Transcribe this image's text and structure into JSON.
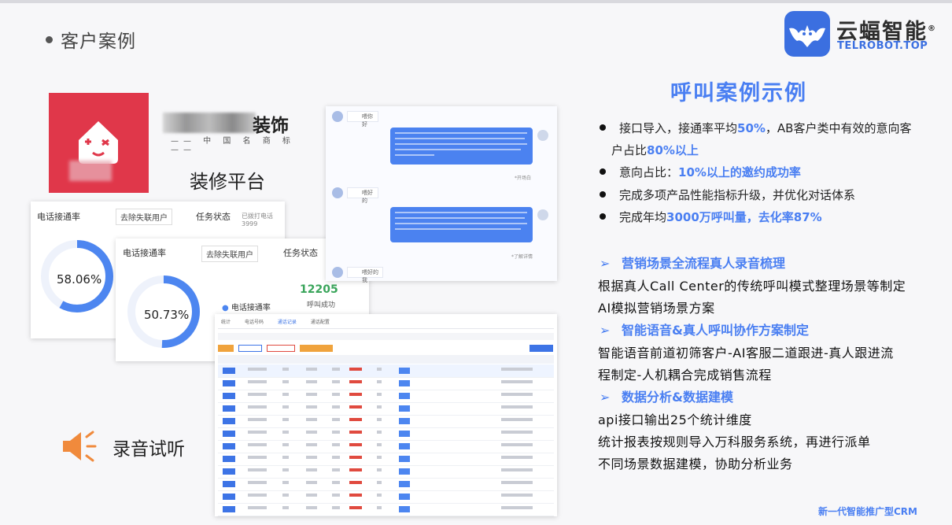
{
  "header": {
    "title": "客户案例"
  },
  "logo": {
    "name": "云蝠智能",
    "reg": "®",
    "domain": "TELROBOT.TOP"
  },
  "left": {
    "brand_suffix": "装饰",
    "brand_line": "—— 中 国 名 商 标 ——",
    "platform_label": "装修平台",
    "card1": {
      "title": "电话接通率",
      "select": "去除失联用户",
      "status_title": "任务状态",
      "status_note": "已拨打电话3999",
      "rate": "58.06%",
      "rate_value": 0.5806
    },
    "card2": {
      "title": "电话接通率",
      "select": "去除失联用户",
      "status_title": "任务状态",
      "rate": "50.73%",
      "rate_value": 0.5073,
      "legend": "电话接通率",
      "calls": "12205",
      "calls_label": "呼叫成功"
    },
    "chat": {
      "voice1": "喂你好",
      "voice2": "喂好的",
      "voice3": "喂好的我",
      "tag1": "*开场白",
      "tag2": "*了解详情"
    },
    "table": {
      "tabs": [
        "统计",
        "电话号码",
        "通话记录",
        "通话配置"
      ]
    },
    "audio_label": "录音试听"
  },
  "right": {
    "heading": "呼叫案例示例",
    "bullets": [
      {
        "pre": "接口导入，接通率平均",
        "hl": "50%",
        "post": "，AB客户类中有效的意向客"
      },
      {
        "pre": "户占比",
        "hl": "80%以上",
        "post": ""
      },
      {
        "pre": "意向占比：",
        "hl": "10%以上的邀约成功率",
        "post": ""
      },
      {
        "pre": "完成多项产品性能指标升级，并优化对话体系",
        "hl": "",
        "post": ""
      },
      {
        "pre": "完成年均",
        "hl": "3000万呼叫量，去化率87%",
        "post": ""
      }
    ],
    "sections": [
      {
        "title": "营销场景全流程真人录音梳理",
        "lines": [
          "根据真人Call Center的传统呼叫模式整理场景等制定",
          "AI模拟营销场景方案"
        ]
      },
      {
        "title": "智能语音&真人呼叫协作方案制定",
        "lines": [
          "智能语音前道初筛客户-AI客服二道跟进-真人跟进流",
          "程制定-人机耦合完成销售流程"
        ]
      },
      {
        "title": "数据分析&数据建模",
        "lines": [
          "api接口输出25个统计维度",
          "统计报表按规则导入万科服务系统，再进行派单",
          "不同场景数据建模，协助分析业务"
        ]
      }
    ],
    "footer": "新一代智能推广型CRM"
  },
  "colors": {
    "accent": "#4a7ff2",
    "tile": "#e0374a",
    "speaker": "#f08a3c"
  }
}
